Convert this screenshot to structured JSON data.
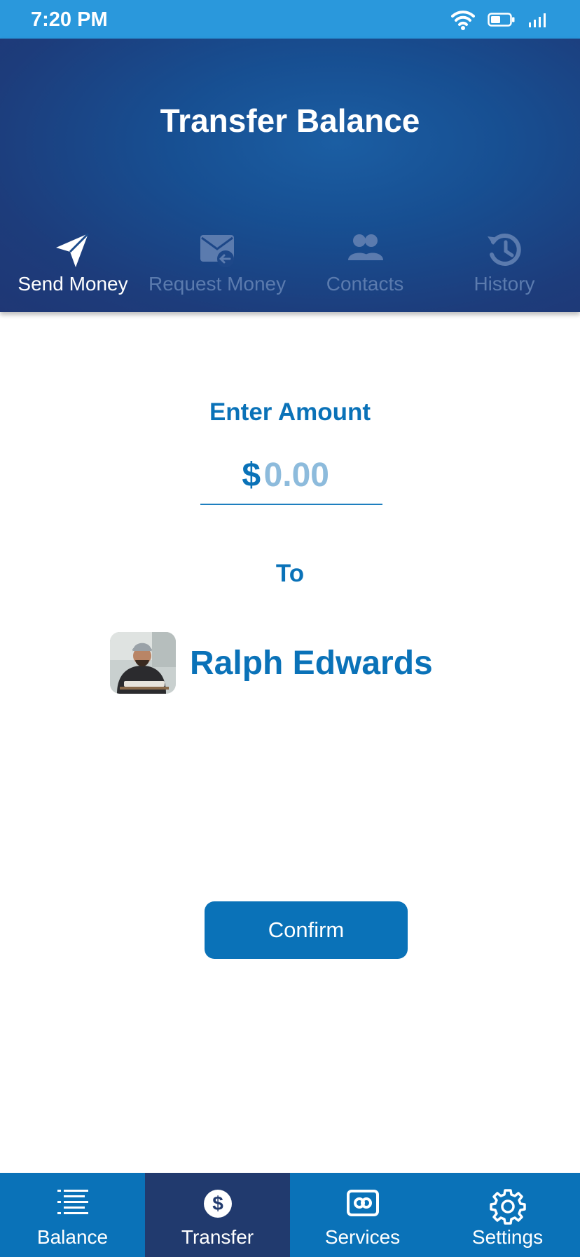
{
  "status_bar": {
    "time": "7:20 PM",
    "icons": [
      "wifi-icon",
      "battery-icon",
      "signal-icon"
    ]
  },
  "header": {
    "title": "Transfer Balance",
    "tabs": [
      {
        "label": "Send Money",
        "icon": "send-icon",
        "active": true
      },
      {
        "label": "Request Money",
        "icon": "mail-request-icon",
        "active": false
      },
      {
        "label": "Contacts",
        "icon": "contacts-icon",
        "active": false
      },
      {
        "label": "History",
        "icon": "history-icon",
        "active": false
      }
    ]
  },
  "form": {
    "amount_label": "Enter Amount",
    "currency_symbol": "$",
    "amount_value": "",
    "amount_placeholder": "0.00",
    "to_label": "To",
    "recipient": {
      "name": "Ralph Edwards",
      "avatar": "avatar-photo"
    },
    "confirm_label": "Confirm"
  },
  "bottom_nav": {
    "items": [
      {
        "label": "Balance",
        "icon": "list-icon",
        "active": false
      },
      {
        "label": "Transfer",
        "icon": "dollar-icon",
        "active": true
      },
      {
        "label": "Services",
        "icon": "services-icon",
        "active": false
      },
      {
        "label": "Settings",
        "icon": "gear-icon",
        "active": false
      }
    ]
  },
  "colors": {
    "status_bar": "#2a98dc",
    "header_dark": "#1f3775",
    "primary": "#0a72b8",
    "nav_active": "#213a6e",
    "inactive_tab": "#5b7bae",
    "placeholder": "#8dbbdc"
  }
}
